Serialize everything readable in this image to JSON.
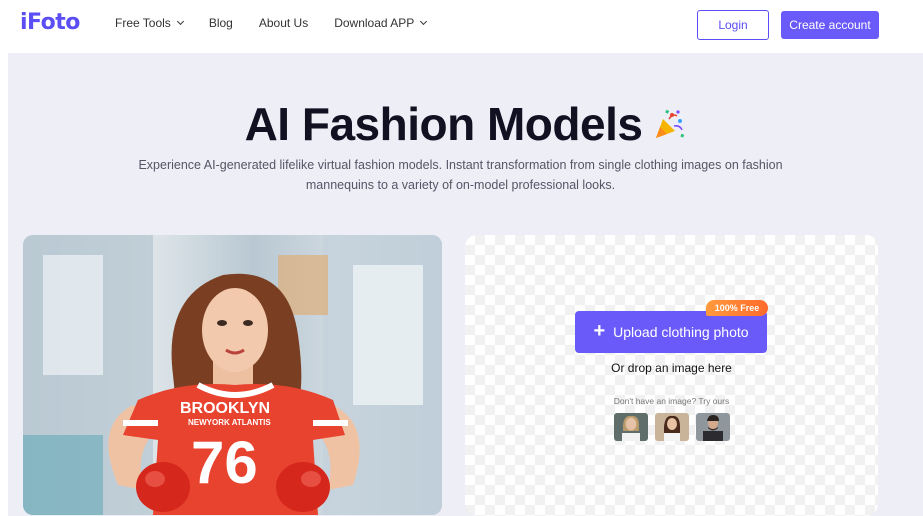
{
  "header": {
    "logo": "iFoto",
    "nav": [
      {
        "label": "Free Tools",
        "has_dropdown": true
      },
      {
        "label": "Blog",
        "has_dropdown": false
      },
      {
        "label": "About Us",
        "has_dropdown": false
      },
      {
        "label": "Download APP",
        "has_dropdown": true
      }
    ],
    "login_label": "Login",
    "create_account_label": "Create account"
  },
  "hero": {
    "title": "AI Fashion Models",
    "title_icon": "party-popper-icon",
    "subtitle_line1": "Experience AI-generated lifelike virtual fashion models. Instant transformation from single clothing images on fashion",
    "subtitle_line2": "mannequins to a variety of on-model professional looks.",
    "shirt_text_top": "BROOKLYN",
    "shirt_text_mid": "NEWYORK ATLANTIS",
    "shirt_number": "76"
  },
  "upload": {
    "badge": "100% Free",
    "button_label": "Upload clothing photo",
    "drop_text": "Or drop an image here",
    "try_text": "Don't have an image? Try ours",
    "samples": [
      "sample-1",
      "sample-2",
      "sample-3"
    ]
  },
  "colors": {
    "accent": "#6a5af9",
    "badge": "#ff7a2c",
    "hero_bg": "#eeeef6",
    "shirt_red": "#e8432f"
  }
}
